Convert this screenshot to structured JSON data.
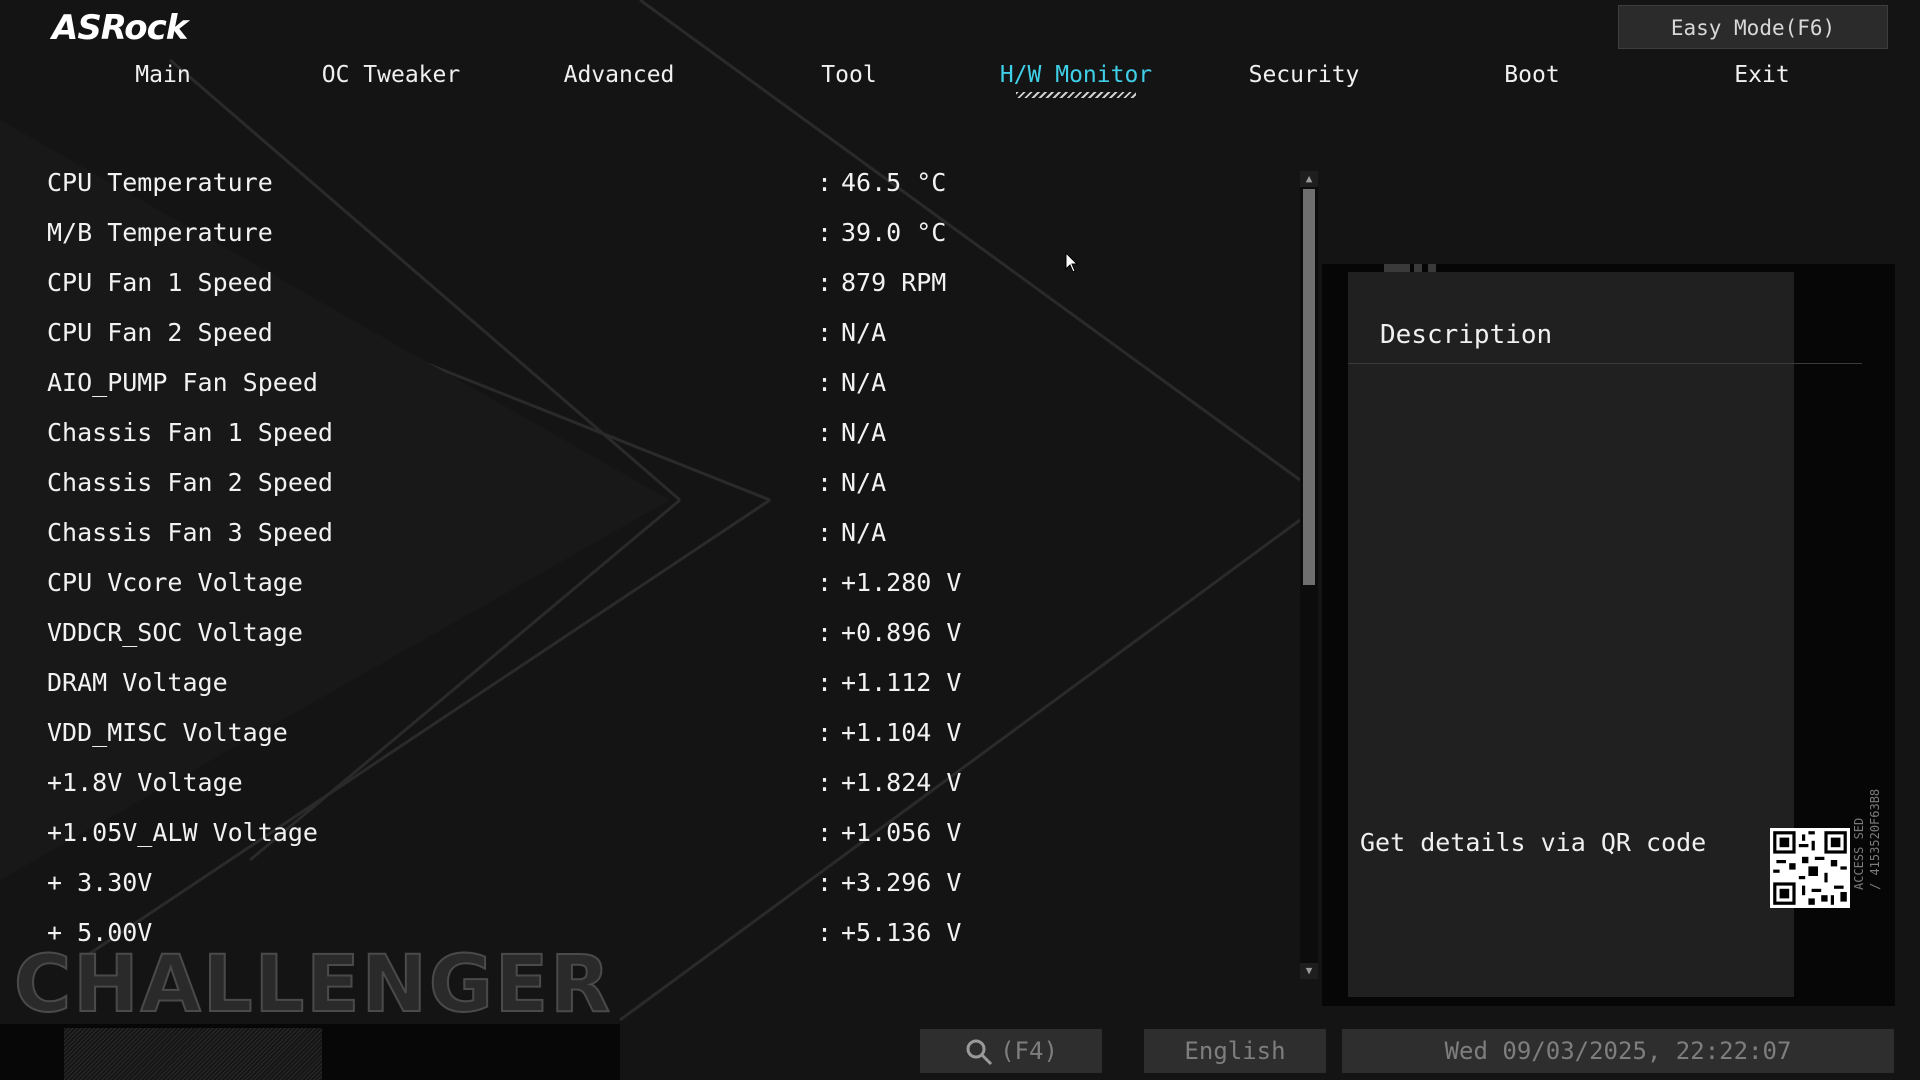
{
  "header": {
    "logo": "ASRock",
    "easy_mode_button": "Easy Mode(F6)"
  },
  "nav": {
    "tabs": [
      {
        "label": "Main",
        "active": false
      },
      {
        "label": "OC Tweaker",
        "active": false
      },
      {
        "label": "Advanced",
        "active": false
      },
      {
        "label": "Tool",
        "active": false
      },
      {
        "label": "H/W Monitor",
        "active": true
      },
      {
        "label": "Security",
        "active": false
      },
      {
        "label": "Boot",
        "active": false
      },
      {
        "label": "Exit",
        "active": false
      }
    ]
  },
  "monitor": {
    "rows": [
      {
        "label": "CPU Temperature",
        "separator": ":",
        "value": "46.5 °C"
      },
      {
        "label": "M/B Temperature",
        "separator": ":",
        "value": "39.0 °C"
      },
      {
        "label": "CPU Fan 1 Speed",
        "separator": ":",
        "value": "879 RPM"
      },
      {
        "label": "CPU Fan 2 Speed",
        "separator": ":",
        "value": "N/A"
      },
      {
        "label": "AIO_PUMP Fan Speed",
        "separator": ":",
        "value": "N/A"
      },
      {
        "label": "Chassis Fan 1 Speed",
        "separator": ":",
        "value": "N/A"
      },
      {
        "label": "Chassis Fan 2 Speed",
        "separator": ":",
        "value": "N/A"
      },
      {
        "label": "Chassis Fan 3 Speed",
        "separator": ":",
        "value": "N/A"
      },
      {
        "label": "CPU Vcore Voltage",
        "separator": ":",
        "value": "+1.280 V"
      },
      {
        "label": "VDDCR_SOC Voltage",
        "separator": ":",
        "value": "+0.896 V"
      },
      {
        "label": "DRAM Voltage",
        "separator": ":",
        "value": "+1.112 V"
      },
      {
        "label": "VDD_MISC Voltage",
        "separator": ":",
        "value": "+1.104 V"
      },
      {
        "label": "+1.8V Voltage",
        "separator": ":",
        "value": "+1.824 V"
      },
      {
        "label": "+1.05V_ALW Voltage",
        "separator": ":",
        "value": "+1.056 V"
      },
      {
        "label": "+ 3.30V",
        "separator": ":",
        "value": "+3.296 V"
      },
      {
        "label": "+ 5.00V",
        "separator": ":",
        "value": "+5.136 V"
      }
    ]
  },
  "description_panel": {
    "title": "Description",
    "qr_text": "Get details via QR code",
    "qr_side_text_1": "ACCESS SED",
    "qr_side_text_2": "/ 4153520F63B8"
  },
  "branding": {
    "watermark": "CHALLENGER"
  },
  "footer": {
    "search_label": "(F4)",
    "language": "English",
    "datetime": "Wed 09/03/2025, 22:22:07"
  },
  "colors": {
    "active_tab": "#3fd0e8",
    "background": "#141414",
    "panel": "#202020"
  },
  "icons": {
    "search": "search-icon",
    "scroll_up": "arrow-up-icon",
    "scroll_down": "arrow-down-icon",
    "cursor": "mouse-cursor-icon"
  }
}
